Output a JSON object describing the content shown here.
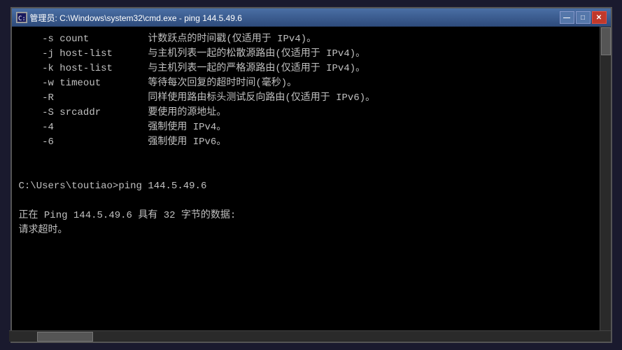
{
  "window": {
    "title": "管理员: C:\\Windows\\system32\\cmd.exe - ping  144.5.49.6",
    "title_short": "管理员: C:\\Windows\\system32\\cmd.exe - ping  144.5.49.6"
  },
  "titlebar": {
    "minimize_label": "—",
    "maximize_label": "□",
    "close_label": "✕"
  },
  "console": {
    "lines": [
      "    -s count          计数跃点的时间戳(仅适用于 IPv4)。",
      "    -j host-list      与主机列表一起的松散源路由(仅适用于 IPv4)。",
      "    -k host-list      与主机列表一起的严格源路由(仅适用于 IPv4)。",
      "    -w timeout        等待每次回复的超时时间(毫秒)。",
      "    -R                同样使用路由标头测试反向路由(仅适用于 IPv6)。",
      "    -S srcaddr        要使用的源地址。",
      "    -4                强制使用 IPv4。",
      "    -6                强制使用 IPv6。",
      "",
      "",
      "C:\\Users\\toutiao>ping 144.5.49.6",
      "",
      "正在 Ping 144.5.49.6 具有 32 字节的数据:",
      "请求超时。"
    ]
  }
}
